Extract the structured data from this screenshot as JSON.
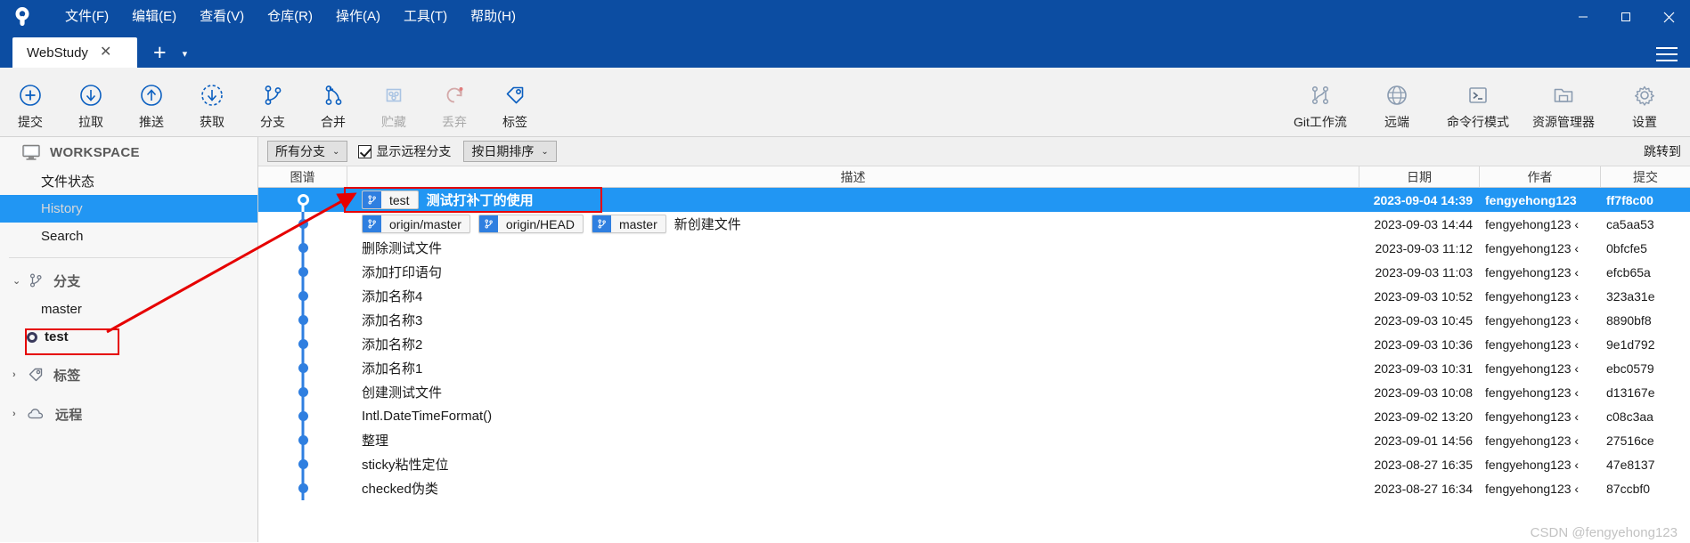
{
  "window": {
    "menus": [
      "文件(F)",
      "编辑(E)",
      "查看(V)",
      "仓库(R)",
      "操作(A)",
      "工具(T)",
      "帮助(H)"
    ],
    "minimize": "—",
    "maximize": "□",
    "close": "✕"
  },
  "tabs": {
    "active_label": "WebStudy",
    "close_glyph": "✕",
    "add_glyph": "+",
    "dropdown_glyph": "▾"
  },
  "toolbar": {
    "left": [
      {
        "label": "提交",
        "icon": "plus-circle-icon",
        "disabled": false
      },
      {
        "label": "拉取",
        "icon": "arrow-down-circle-icon",
        "disabled": false
      },
      {
        "label": "推送",
        "icon": "arrow-up-circle-icon",
        "disabled": false
      },
      {
        "label": "获取",
        "icon": "fetch-dashed-circle-icon",
        "disabled": false
      },
      {
        "label": "分支",
        "icon": "branch-icon",
        "disabled": false
      },
      {
        "label": "合并",
        "icon": "merge-icon",
        "disabled": false
      },
      {
        "label": "贮藏",
        "icon": "stash-icon",
        "disabled": true
      },
      {
        "label": "丢弃",
        "icon": "discard-icon",
        "disabled": true
      },
      {
        "label": "标签",
        "icon": "tag-icon",
        "disabled": false
      }
    ],
    "right": [
      {
        "label": "Git工作流",
        "icon": "gitflow-icon"
      },
      {
        "label": "远端",
        "icon": "globe-icon"
      },
      {
        "label": "命令行模式",
        "icon": "terminal-icon"
      },
      {
        "label": "资源管理器",
        "icon": "folder-icon"
      },
      {
        "label": "设置",
        "icon": "gear-icon"
      }
    ]
  },
  "sidebar": {
    "workspace": {
      "title": "WORKSPACE",
      "icon": "monitor-icon",
      "items": [
        {
          "label": "文件状态",
          "selected": false
        },
        {
          "label": "History",
          "selected": true
        },
        {
          "label": "Search",
          "selected": false
        }
      ]
    },
    "sections": [
      {
        "title": "分支",
        "icon": "branch-icon",
        "expanded": true,
        "arrow": "⌄",
        "items": [
          {
            "label": "master",
            "current": false
          },
          {
            "label": "test",
            "current": true
          }
        ]
      },
      {
        "title": "标签",
        "icon": "tag-icon",
        "expanded": false,
        "arrow": "›",
        "items": []
      },
      {
        "title": "远程",
        "icon": "cloud-icon",
        "expanded": false,
        "arrow": "›",
        "items": []
      }
    ]
  },
  "filterbar": {
    "branch_filter": {
      "value": "所有分支",
      "caret": "⌄"
    },
    "show_remote": {
      "label": "显示远程分支",
      "checked": true
    },
    "sort": {
      "value": "按日期排序",
      "caret": "⌄"
    },
    "goto_label": "跳转到"
  },
  "table": {
    "columns": [
      {
        "key": "graph",
        "label": "图谱"
      },
      {
        "key": "desc",
        "label": "描述"
      },
      {
        "key": "date",
        "label": "日期"
      },
      {
        "key": "auth",
        "label": "作者"
      },
      {
        "key": "hash",
        "label": "提交"
      }
    ],
    "rows": [
      {
        "selected": true,
        "badges": [
          {
            "text": "test",
            "current": true
          }
        ],
        "desc": "测试打补丁的使用",
        "date": "2023-09-04 14:39",
        "author": "fengyehong123",
        "hash": "ff7f8c00"
      },
      {
        "selected": false,
        "badges": [
          {
            "text": "origin/master",
            "current": false
          },
          {
            "text": "origin/HEAD",
            "current": false
          },
          {
            "text": "master",
            "current": false
          }
        ],
        "desc": "新创建文件",
        "date": "2023-09-03 14:44",
        "author": "fengyehong123 ‹",
        "hash": "ca5aa53"
      },
      {
        "selected": false,
        "badges": [],
        "desc": "删除测试文件",
        "date": "2023-09-03 11:12",
        "author": "fengyehong123 ‹",
        "hash": "0bfcfe5"
      },
      {
        "selected": false,
        "badges": [],
        "desc": "添加打印语句",
        "date": "2023-09-03 11:03",
        "author": "fengyehong123 ‹",
        "hash": "efcb65a"
      },
      {
        "selected": false,
        "badges": [],
        "desc": "添加名称4",
        "date": "2023-09-03 10:52",
        "author": "fengyehong123 ‹",
        "hash": "323a31e"
      },
      {
        "selected": false,
        "badges": [],
        "desc": "添加名称3",
        "date": "2023-09-03 10:45",
        "author": "fengyehong123 ‹",
        "hash": "8890bf8"
      },
      {
        "selected": false,
        "badges": [],
        "desc": "添加名称2",
        "date": "2023-09-03 10:36",
        "author": "fengyehong123 ‹",
        "hash": "9e1d792"
      },
      {
        "selected": false,
        "badges": [],
        "desc": "添加名称1",
        "date": "2023-09-03 10:31",
        "author": "fengyehong123 ‹",
        "hash": "ebc0579"
      },
      {
        "selected": false,
        "badges": [],
        "desc": "创建测试文件",
        "date": "2023-09-03 10:08",
        "author": "fengyehong123 ‹",
        "hash": "d13167e"
      },
      {
        "selected": false,
        "badges": [],
        "desc": "Intl.DateTimeFormat()",
        "date": "2023-09-02 13:20",
        "author": "fengyehong123 ‹",
        "hash": "c08c3aa"
      },
      {
        "selected": false,
        "badges": [],
        "desc": "整理",
        "date": "2023-09-01 14:56",
        "author": "fengyehong123 ‹",
        "hash": "27516ce"
      },
      {
        "selected": false,
        "badges": [],
        "desc": "sticky粘性定位",
        "date": "2023-08-27 16:35",
        "author": "fengyehong123 ‹",
        "hash": "47e8137"
      },
      {
        "selected": false,
        "badges": [],
        "desc": "checked伪类",
        "date": "2023-08-27 16:34",
        "author": "fengyehong123 ‹",
        "hash": "87ccbf0"
      }
    ]
  },
  "annotation": {
    "highlight_color": "#e60000",
    "watermark": "CSDN @fengyehong123"
  }
}
